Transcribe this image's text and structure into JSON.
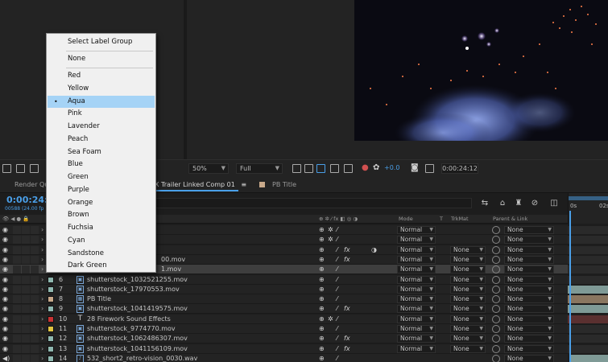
{
  "viewer": {
    "zoom": "50%",
    "resolution": "Full",
    "exposure": "+0.0",
    "current_time": "0:00:24:12"
  },
  "tabs": {
    "render_queue": "Render Que",
    "comp": "X Trailer Linked Comp 01",
    "comp_menu": "≡",
    "pb_title": "PB Title"
  },
  "timeline": {
    "timecode": "0:00:24:1",
    "frames": "00588 (24.00 fp",
    "ruler_labels": [
      "0s",
      "02s"
    ]
  },
  "columns": {
    "mode": "Mode",
    "t": "T",
    "trkmat": "TrkMat",
    "parent": "Parent & Link"
  },
  "context_menu": {
    "title": "Select Label Group",
    "none": "None",
    "items": [
      "Red",
      "Yellow",
      "Aqua",
      "Pink",
      "Lavender",
      "Peach",
      "Sea Foam",
      "Blue",
      "Green",
      "Purple",
      "Orange",
      "Brown",
      "Fuchsia",
      "Cyan",
      "Sandstone",
      "Dark Green"
    ],
    "selected": "Aqua",
    "bullet": "•"
  },
  "layers": [
    {
      "num": "",
      "name": "",
      "mode": "Normal",
      "trkmat": "",
      "parent": "None",
      "label_color": "#8fb8b0"
    },
    {
      "num": "",
      "name": "",
      "mode": "Normal",
      "trkmat": "",
      "parent": "None",
      "label_color": "#8fb8b0"
    },
    {
      "num": "",
      "name": "",
      "mode": "Normal",
      "trkmat": "None",
      "parent": "None",
      "label_color": "#8fb8b0"
    },
    {
      "num": "",
      "name": "00.mov",
      "mode": "Normal",
      "trkmat": "None",
      "parent": "None",
      "label_color": "#8fb8b0"
    },
    {
      "num": "",
      "name": "1.mov",
      "mode": "Normal",
      "trkmat": "None",
      "parent": "None",
      "label_color": "#8fb8b0"
    },
    {
      "num": "6",
      "name": "shutterstock_1032521255.mov",
      "mode": "Normal",
      "trkmat": "None",
      "parent": "None",
      "label_color": "#8fb8b0"
    },
    {
      "num": "7",
      "name": "shutterstock_17970553.mov",
      "mode": "Normal",
      "trkmat": "None",
      "parent": "None",
      "label_color": "#8fb8b0"
    },
    {
      "num": "8",
      "name": "PB Title",
      "mode": "Normal",
      "trkmat": "None",
      "parent": "None",
      "label_color": "#c8a98a"
    },
    {
      "num": "9",
      "name": "shutterstock_1041419575.mov",
      "mode": "Normal",
      "trkmat": "None",
      "parent": "None",
      "label_color": "#8fb8b0"
    },
    {
      "num": "10",
      "name": "28 Firework Sound Effects",
      "mode": "Normal",
      "trkmat": "None",
      "parent": "None",
      "label_color": "#c83232"
    },
    {
      "num": "11",
      "name": "shutterstock_9774770.mov",
      "mode": "Normal",
      "trkmat": "None",
      "parent": "None",
      "label_color": "#e0c440"
    },
    {
      "num": "12",
      "name": "shutterstock_1062486307.mov",
      "mode": "Normal",
      "trkmat": "None",
      "parent": "None",
      "label_color": "#8fb8b0"
    },
    {
      "num": "13",
      "name": "shutterstock_1041156109.mov",
      "mode": "Normal",
      "trkmat": "None",
      "parent": "None",
      "label_color": "#8fb8b0"
    },
    {
      "num": "14",
      "name": "532_short2_retro-vision_0030.wav",
      "mode": "",
      "trkmat": "",
      "parent": "None",
      "label_color": "#8fb8b0"
    }
  ],
  "colors": {
    "accent": "#4a9fe8",
    "menu_highlight": "#a5d3f6"
  }
}
